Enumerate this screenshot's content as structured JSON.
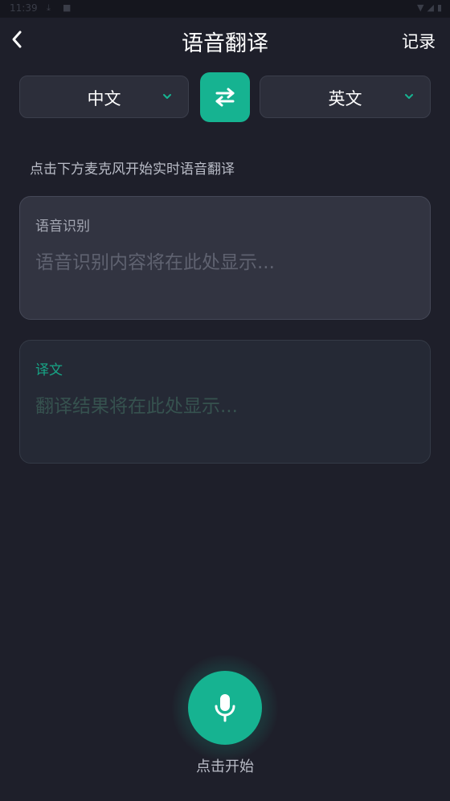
{
  "status_bar": {
    "time": "11:39",
    "icons": [
      "download-icon",
      "notification-icon",
      "wifi-icon",
      "signal-icon",
      "battery-icon"
    ]
  },
  "header": {
    "title": "语音翻译",
    "history_label": "记录",
    "back_icon": "chevron-left-icon"
  },
  "languages": {
    "source": "中文",
    "target": "英文",
    "swap_icon": "swap-arrows-icon"
  },
  "hint": "点击下方麦克风开始实时语音翻译",
  "recognition": {
    "label": "语音识别",
    "placeholder": "语音识别内容将在此处显示..."
  },
  "translation": {
    "label": "译文",
    "placeholder": "翻译结果将在此处显示..."
  },
  "mic": {
    "icon": "microphone-icon",
    "caption": "点击开始"
  },
  "colors": {
    "background": "#1e1f2a",
    "accent": "#16b391",
    "card": "#323441",
    "translation_card": "#252935"
  }
}
